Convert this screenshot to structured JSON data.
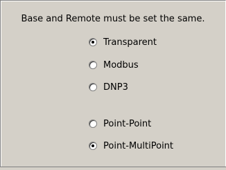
{
  "note": "Base and Remote must be set the same.",
  "protocol_group": [
    {
      "label": "Transparent",
      "checked": true
    },
    {
      "label": "Modbus",
      "checked": false
    },
    {
      "label": "DNP3",
      "checked": false
    }
  ],
  "topology_group": [
    {
      "label": "Point-Point",
      "checked": false
    },
    {
      "label": "Point-MultiPoint",
      "checked": true
    }
  ]
}
